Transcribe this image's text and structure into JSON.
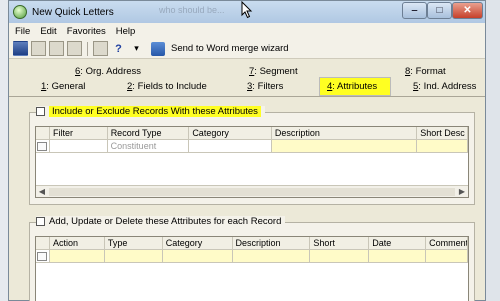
{
  "window": {
    "title": "New Quick Letters",
    "ghost_title": "who should be..."
  },
  "menu": [
    "File",
    "Edit",
    "Favorites",
    "Help"
  ],
  "toolbar": {
    "word_merge_label": "Send to Word merge wizard"
  },
  "tabs": {
    "row1": [
      {
        "num": "6",
        "label": ": Org. Address"
      },
      {
        "num": "7",
        "label": ": Segment"
      },
      {
        "num": "8",
        "label": ": Format"
      }
    ],
    "row2": [
      {
        "num": "1",
        "label": ": General"
      },
      {
        "num": "2",
        "label": ": Fields to Include"
      },
      {
        "num": "3",
        "label": ": Filters"
      },
      {
        "num": "4",
        "label": ": Attributes"
      },
      {
        "num": "5",
        "label": ": Ind. Address"
      }
    ],
    "active": "4"
  },
  "group1": {
    "label": "Include or Exclude Records With these Attributes",
    "columns": [
      "Filter",
      "Record Type",
      "Category",
      "Description",
      "Short Desc"
    ],
    "row": [
      "",
      "Constituent",
      "",
      "",
      ""
    ]
  },
  "group2": {
    "label": "Add, Update or Delete these Attributes for each Record",
    "columns": [
      "Action",
      "Type",
      "Category",
      "Description",
      "Short",
      "Date",
      "Comment"
    ],
    "row": [
      "",
      "",
      "",
      "",
      "",
      "",
      ""
    ]
  }
}
